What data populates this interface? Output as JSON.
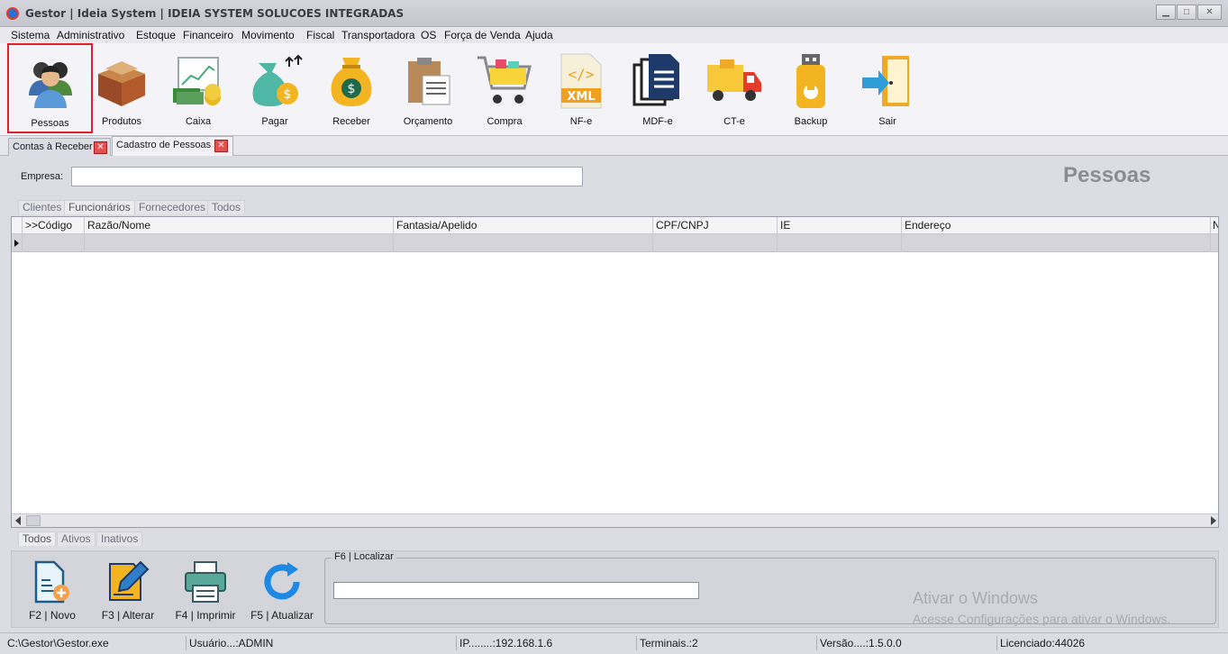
{
  "window": {
    "title": "Gestor | Ideia System | IDEIA SYSTEM SOLUCOES INTEGRADAS",
    "controls": [
      "minimize",
      "maximize",
      "close"
    ]
  },
  "menu": [
    "Sistema",
    "Administrativo",
    "Estoque",
    "Financeiro",
    "Movimento",
    "Fiscal",
    "Transportadora",
    "OS",
    "Força de Venda",
    "Ajuda"
  ],
  "toolbar": [
    {
      "label": "Pessoas",
      "icon": "people-icon",
      "active": true
    },
    {
      "label": "Produtos",
      "icon": "product-box-icon"
    },
    {
      "label": "Caixa",
      "icon": "cash-register-icon"
    },
    {
      "label": "Pagar",
      "icon": "money-bag-pay-icon"
    },
    {
      "label": "Receber",
      "icon": "money-bag-receive-icon"
    },
    {
      "label": "Orçamento",
      "icon": "clipboard-icon"
    },
    {
      "label": "Compra",
      "icon": "shopping-cart-icon"
    },
    {
      "label": "NF-e",
      "icon": "xml-file-icon"
    },
    {
      "label": "MDF-e",
      "icon": "documents-icon"
    },
    {
      "label": "CT-e",
      "icon": "truck-icon"
    },
    {
      "label": "Backup",
      "icon": "usb-drive-icon"
    },
    {
      "label": "Sair",
      "icon": "exit-door-icon"
    }
  ],
  "doc_tabs": [
    {
      "label": "Contas à Receber",
      "active": false
    },
    {
      "label": "Cadastro de Pessoas",
      "active": true
    }
  ],
  "form": {
    "empresa_label": "Empresa:",
    "empresa_value": "",
    "page_title": "Pessoas"
  },
  "type_tabs": [
    {
      "label": "Clientes",
      "active": false
    },
    {
      "label": "Funcionários",
      "active": true
    },
    {
      "label": "Fornecedores",
      "active": false
    },
    {
      "label": "Todos",
      "active": false
    }
  ],
  "grid": {
    "columns": [
      ">>Código",
      "Razão/Nome",
      "Fantasia/Apelido",
      "CPF/CNPJ",
      "IE",
      "Endereço",
      "N"
    ],
    "rows": []
  },
  "status_tabs": [
    {
      "label": "Todos",
      "active": true
    },
    {
      "label": "Ativos",
      "active": false
    },
    {
      "label": "Inativos",
      "active": false
    }
  ],
  "actions": [
    {
      "label": "F2 | Novo",
      "icon": "new-document-icon"
    },
    {
      "label": "F3 | Alterar",
      "icon": "edit-pencil-icon"
    },
    {
      "label": "F4 | Imprimir",
      "icon": "printer-icon"
    },
    {
      "label": "F5 | Atualizar",
      "icon": "refresh-icon"
    }
  ],
  "search": {
    "legend": "F6 | Localizar",
    "value": ""
  },
  "watermark": {
    "line1": "Ativar o Windows",
    "line2": "Acesse Configurações para ativar o Windows."
  },
  "statusbar": {
    "path": "C:\\Gestor\\Gestor.exe",
    "user": "Usuário...:ADMIN",
    "ip": "IP........:192.168.1.6",
    "terminals": "Terminais.:2",
    "version": "Versão....:1.5.0.0",
    "license": "Licenciado:44026"
  },
  "colors": {
    "accent_active": "#e3202a",
    "background": "#dcdce3",
    "title_gray": "#8c8c94"
  }
}
